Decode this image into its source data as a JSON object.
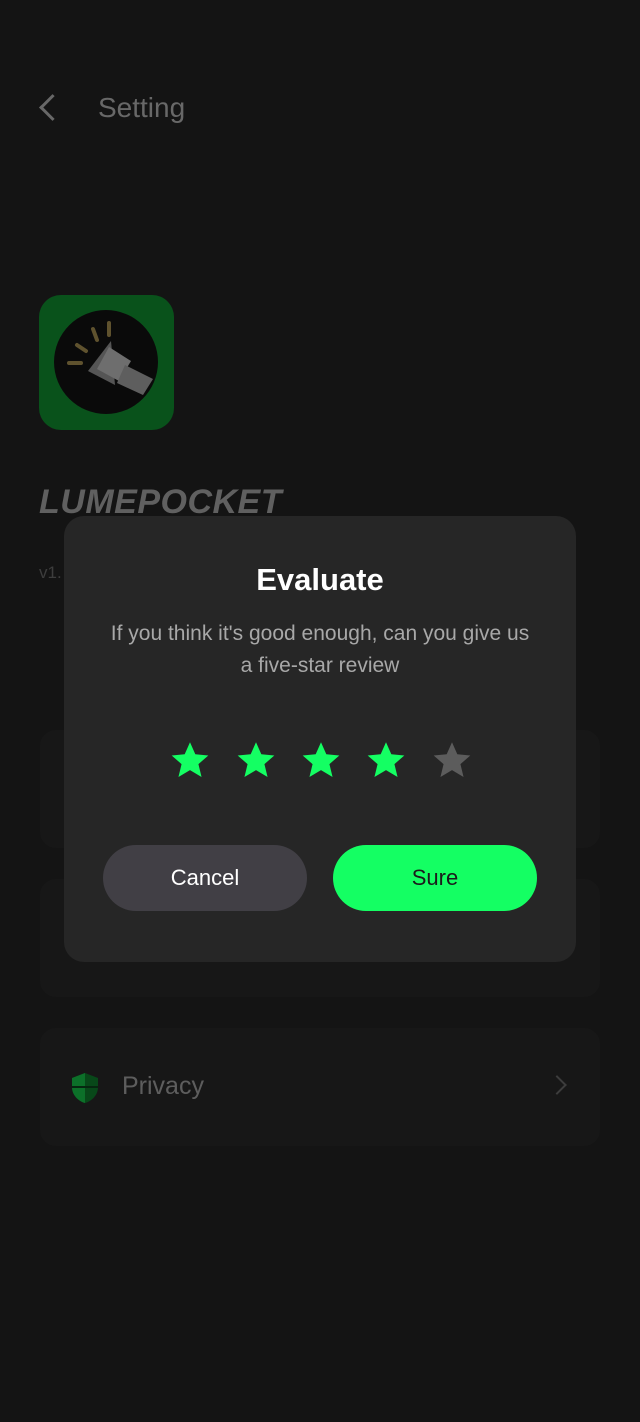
{
  "header": {
    "title": "Setting",
    "back_icon": "chevron-left-icon"
  },
  "app": {
    "name": "LUMEPOCKET",
    "version": "v1.",
    "logo_icon": "flashlight-icon"
  },
  "settings": [
    {
      "label": ""
    },
    {
      "label": ""
    },
    {
      "label": "Privacy",
      "icon": "shield-icon"
    }
  ],
  "dialog": {
    "title": "Evaluate",
    "message": "If you think it's good enough, can you give us a five-star review",
    "rating": 4,
    "max_rating": 5,
    "cancel_label": "Cancel",
    "sure_label": "Sure"
  },
  "colors": {
    "accent": "#14ff63",
    "star_active": "#14ff63",
    "star_inactive": "#5c5c5c",
    "dialog_bg": "#262626",
    "cancel_bg": "#413f45",
    "logo_bg": "#0e7a29"
  }
}
